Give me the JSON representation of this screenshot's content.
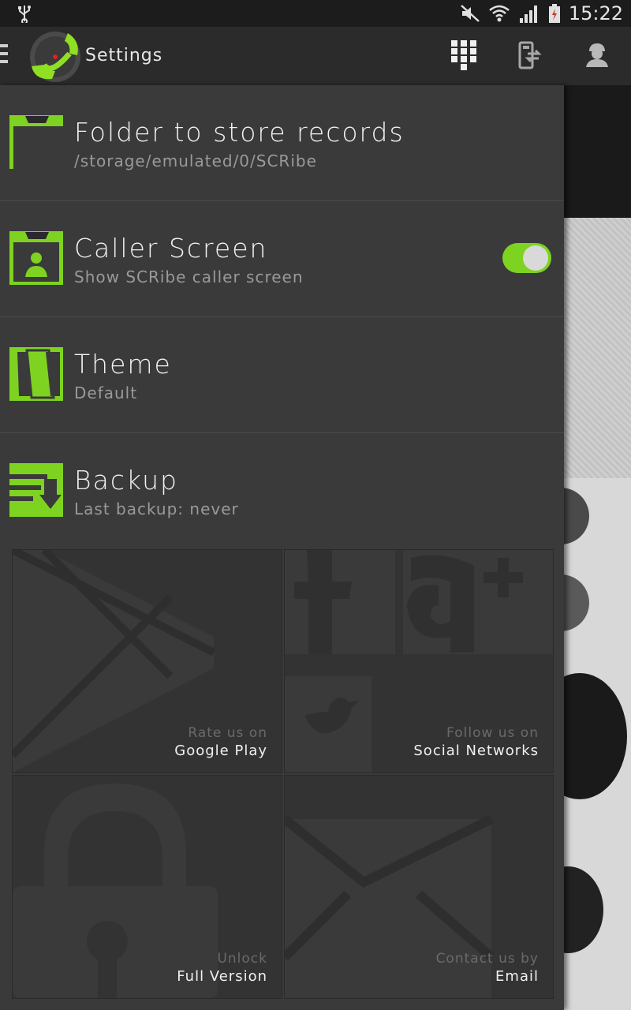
{
  "status_bar": {
    "time": "15:22",
    "icons": [
      "usb-icon",
      "mute-icon",
      "wifi-icon",
      "signal-icon",
      "battery-icon"
    ]
  },
  "action_bar": {
    "title": "Settings",
    "icons": [
      "menu-icon",
      "dialpad-icon",
      "transfer-icon",
      "account-icon"
    ]
  },
  "settings": [
    {
      "icon": "folder-icon",
      "title": "Folder to store records",
      "subtitle": "/storage/emulated/0/SCRibe"
    },
    {
      "icon": "caller-screen-icon",
      "title": "Caller Screen",
      "subtitle": "Show SCRibe caller screen",
      "toggle": true
    },
    {
      "icon": "theme-icon",
      "title": "Theme",
      "subtitle": "Default"
    },
    {
      "icon": "backup-icon",
      "title": "Backup",
      "subtitle": "Last backup: never"
    }
  ],
  "tiles": [
    {
      "icon": "google-play-icon",
      "line1": "Rate us on",
      "line2": "Google Play"
    },
    {
      "icon": "social-networks-icon",
      "line1": "Follow us on",
      "line2": "Social Networks"
    },
    {
      "icon": "lock-icon",
      "line1": "Unlock",
      "line2": "Full Version"
    },
    {
      "icon": "email-icon",
      "line1": "Contact us by",
      "line2": "Email"
    }
  ],
  "colors": {
    "accent": "#7ed320",
    "drawer_bg": "#3a3a3a",
    "action_bar_bg": "#2b2b2b",
    "status_bar_bg": "#1c1c1c"
  }
}
